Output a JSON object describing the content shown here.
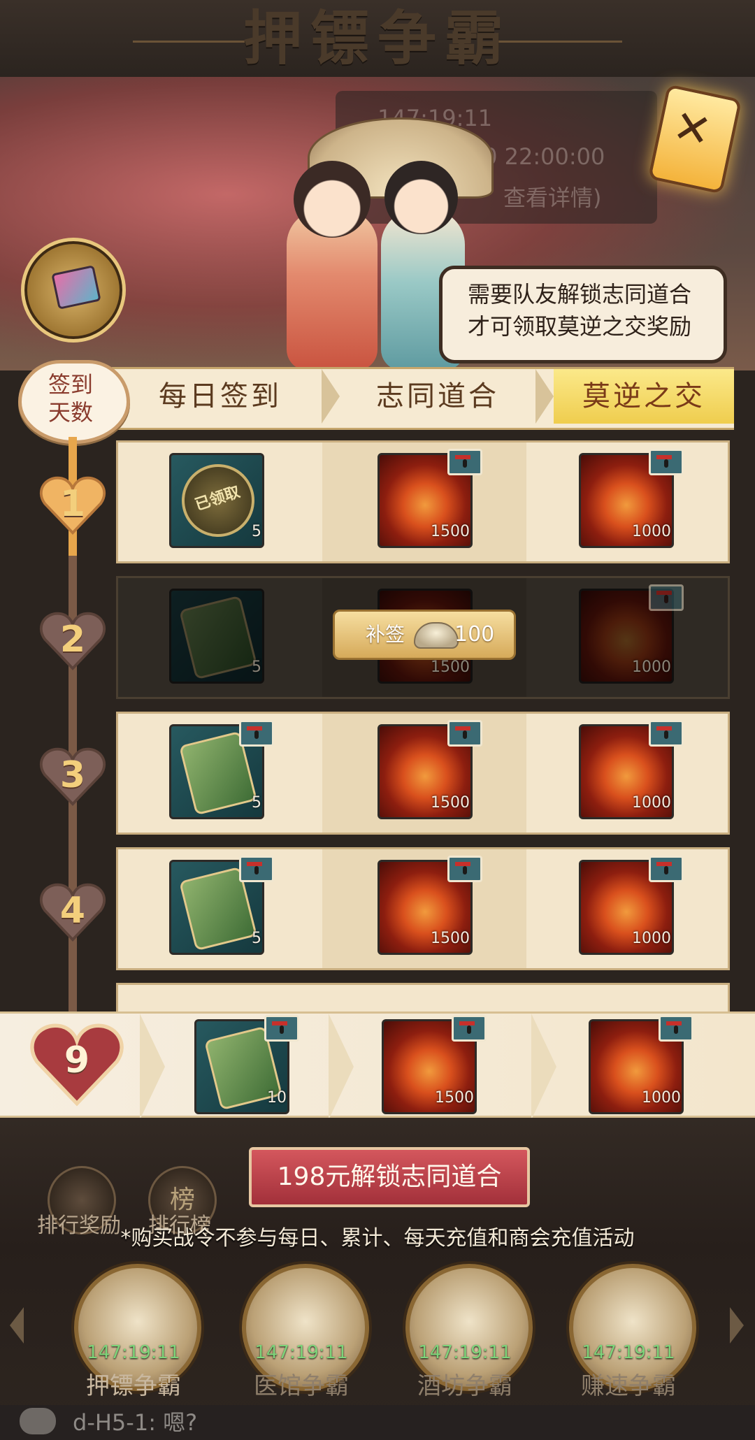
{
  "header": {
    "title": "押镖争霸"
  },
  "banner": {
    "timer_text": "147:19:11",
    "end_text": "/20 22:00:00",
    "detail_text": "查看详情)",
    "speech": [
      "需要队友解锁志同道合",
      "才可领取莫逆之交奖励"
    ]
  },
  "tabs": {
    "badge_lines": [
      "签到",
      "天数"
    ],
    "items": [
      {
        "label": "每日签到"
      },
      {
        "label": "志同道合"
      },
      {
        "label": "莫逆之交"
      }
    ],
    "active_index": 2
  },
  "rows": [
    {
      "day": "1",
      "item1_qty": "5",
      "item2_qty": "1500",
      "item3_qty": "1000",
      "claimed_text": "已领取"
    },
    {
      "day": "2",
      "item1_qty": "5",
      "item2_qty": "1500",
      "item3_qty": "1000",
      "makeup_label": "补签",
      "makeup_amount": "100"
    },
    {
      "day": "3",
      "item1_qty": "5",
      "item2_qty": "1500",
      "item3_qty": "1000"
    },
    {
      "day": "4",
      "item1_qty": "5",
      "item2_qty": "1500",
      "item3_qty": "1000"
    }
  ],
  "sticky_row": {
    "day": "9",
    "item1_qty": "10",
    "item2_qty": "1500",
    "item3_qty": "1000"
  },
  "unlock_button": "198元解锁志同道合",
  "notice": "*购买战令不参与每日、累计、每天充值和商会充值活动",
  "side_icons": [
    {
      "label": "排行奖励",
      "icon": "coin-icon"
    },
    {
      "label": "排行榜",
      "icon": "scroll-icon"
    }
  ],
  "scroll_icon_glyph": "榜",
  "modes": [
    {
      "label": "押镖争霸",
      "timer": "147:19:11"
    },
    {
      "label": "医馆争霸",
      "timer": "147:19:11"
    },
    {
      "label": "酒坊争霸",
      "timer": "147:19:11"
    },
    {
      "label": "赚速争霸",
      "timer": "147:19:11"
    }
  ],
  "chat": {
    "text": "d-H5-1: 嗯?"
  },
  "colors": {
    "accent_gold": "#efcd4e",
    "unlock_red": "#a2303a",
    "timer_green": "#7ed47a"
  }
}
